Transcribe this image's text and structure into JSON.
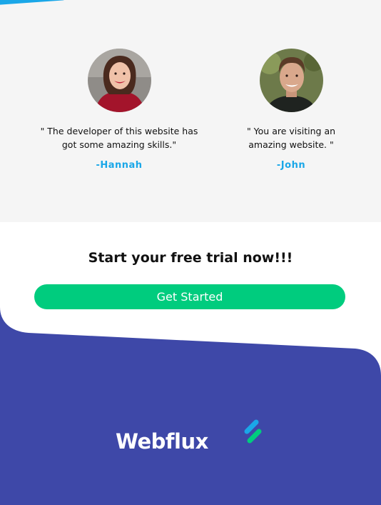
{
  "testimonials": [
    {
      "quote": "\" The developer of this website has got some amazing skills.\"",
      "author": "-Hannah"
    },
    {
      "quote": "\" You are visiting an amazing website. \"",
      "author": "-John"
    }
  ],
  "cta": {
    "title": "Start your free trial now!!!",
    "button_label": "Get Started"
  },
  "footer": {
    "brand": "Webflux"
  },
  "colors": {
    "accent_blue": "#1aa7e8",
    "button_green": "#00cc7e",
    "footer_indigo": "#3e48a8",
    "testimonial_bg": "#f5f5f5"
  },
  "icons": {
    "avatar_1": "woman-portrait",
    "avatar_2": "man-portrait",
    "logo": "webflux-logo-icon"
  }
}
